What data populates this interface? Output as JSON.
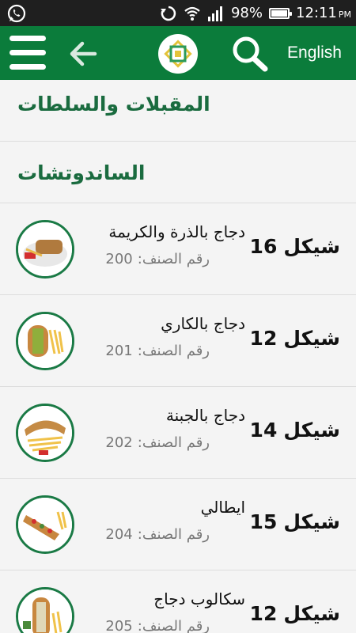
{
  "status_bar": {
    "battery": "98%",
    "battery_level": 0.98,
    "time": "12:11",
    "ampm": "PM",
    "left_icon": "whatsapp-icon",
    "icons": [
      "sync-icon",
      "wifi-icon",
      "signal-icon",
      "battery-icon"
    ]
  },
  "appbar": {
    "language_label": "English",
    "color": "#0b7c3b"
  },
  "categories": [
    {
      "title": "المقبلات والسلطات"
    },
    {
      "title": "الساندوتشات"
    }
  ],
  "items": [
    {
      "name": "دجاج بالذرة والكريمة",
      "code_label": "رقم الصنف:",
      "code": "200",
      "price": "16",
      "currency": "شيكل"
    },
    {
      "name": "دجاج بالكاري",
      "code_label": "رقم الصنف:",
      "code": "201",
      "price": "12",
      "currency": "شيكل"
    },
    {
      "name": "دجاج بالجبنة",
      "code_label": "رقم الصنف:",
      "code": "202",
      "price": "14",
      "currency": "شيكل"
    },
    {
      "name": "ايطالي",
      "code_label": "رقم الصنف:",
      "code": "204",
      "price": "15",
      "currency": "شيكل"
    },
    {
      "name": "سكالوب دجاج",
      "code_label": "رقم الصنف:",
      "code": "205",
      "price": "12",
      "currency": "شيكل"
    }
  ]
}
